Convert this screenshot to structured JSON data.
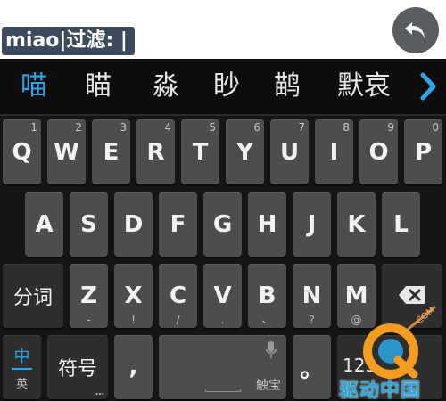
{
  "input": {
    "text": "miao|过滤: |"
  },
  "candidates": {
    "items": [
      "喵",
      "瞄",
      "淼",
      "眇",
      "鹋",
      "默哀"
    ]
  },
  "keyboard": {
    "row1": [
      {
        "main": "Q",
        "num": "1"
      },
      {
        "main": "W",
        "num": "2"
      },
      {
        "main": "E",
        "num": "3"
      },
      {
        "main": "R",
        "num": "4"
      },
      {
        "main": "T",
        "num": "5"
      },
      {
        "main": "Y",
        "num": "6"
      },
      {
        "main": "U",
        "num": "7"
      },
      {
        "main": "I",
        "num": "8"
      },
      {
        "main": "O",
        "num": "9"
      },
      {
        "main": "P",
        "num": "0"
      }
    ],
    "row2": [
      "A",
      "S",
      "D",
      "F",
      "G",
      "H",
      "J",
      "K",
      "L"
    ],
    "row3": [
      {
        "main": "Z",
        "sub": "-"
      },
      {
        "main": "X",
        "sub": "!"
      },
      {
        "main": "C",
        "sub": "/"
      },
      {
        "main": "V",
        "sub": "."
      },
      {
        "main": "B",
        "sub": "、"
      },
      {
        "main": "N",
        "sub": "?"
      },
      {
        "main": "M",
        "sub": "@"
      }
    ],
    "fenci_label": "分词",
    "lang_primary": "中",
    "lang_secondary": "英",
    "symbol_label": "符号",
    "comma_label": ",",
    "space_label": "触宝",
    "period_label": "。",
    "num_label": "123"
  },
  "watermark": {
    "text": "驱动中国",
    "domain": "COM"
  },
  "colors": {
    "accent": "#2aa6e6",
    "key": "#4d4d4d",
    "key_dark": "#2e2e2e"
  }
}
